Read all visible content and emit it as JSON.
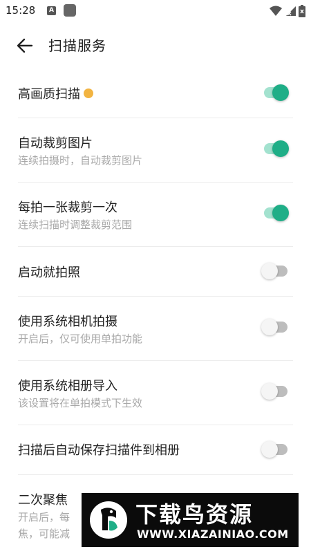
{
  "status_bar": {
    "time": "15:28",
    "a_label": "A",
    "icons": [
      "notification-a-icon",
      "app-square-icon",
      "wifi-icon",
      "signal-icon",
      "battery-icon"
    ]
  },
  "header": {
    "title": "扫描服务",
    "back_icon": "arrow-left-icon"
  },
  "settings": [
    {
      "title": "高画质扫描",
      "subtitle": "",
      "enabled": true,
      "premium": true
    },
    {
      "title": "自动裁剪图片",
      "subtitle": "连续拍摄时，自动裁剪图片",
      "enabled": true
    },
    {
      "title": "每拍一张裁剪一次",
      "subtitle": "连续扫描时调整裁剪范围",
      "enabled": true
    },
    {
      "title": "启动就拍照",
      "subtitle": "",
      "enabled": false
    },
    {
      "title": "使用系统相机拍摄",
      "subtitle": "开启后，仅可使用单拍功能",
      "enabled": false
    },
    {
      "title": "使用系统相册导入",
      "subtitle": "该设置将在单拍模式下生效",
      "enabled": false
    },
    {
      "title": "扫描后自动保存扫描件到相册",
      "subtitle": "",
      "enabled": false
    },
    {
      "title": "二次聚焦",
      "subtitle": "开启后，每",
      "subtitle2": "焦，可能减"
    }
  ],
  "watermark": {
    "cn_text": "下载鸟资源",
    "url": "WWW.XIAZAINIAO.COM"
  },
  "colors": {
    "toggle_on_thumb": "#1fae87",
    "toggle_on_track": "#a3e2cf",
    "toggle_off_thumb": "#f5f5f5",
    "toggle_off_track": "#bdbdbd",
    "premium_badge": "#f2b441"
  }
}
